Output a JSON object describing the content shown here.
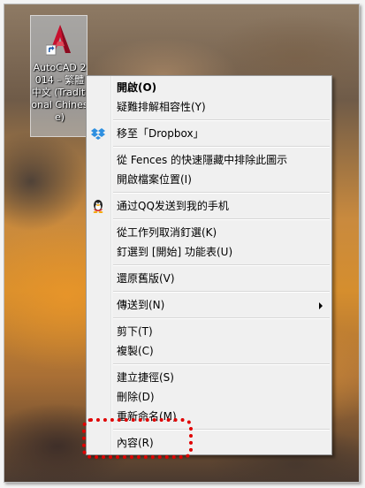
{
  "desktop_icon": {
    "label": "AutoCAD 2014 – 繁體中文 (Traditional Chinese)"
  },
  "context_menu": {
    "groups": [
      [
        {
          "label": "開啟(O)",
          "bold": true
        },
        {
          "label": "疑難排解相容性(Y)"
        }
      ],
      [
        {
          "label": "移至「Dropbox」",
          "icon": "dropbox-icon"
        }
      ],
      [
        {
          "label": "從 Fences 的快速隱藏中排除此圖示"
        },
        {
          "label": "開啟檔案位置(I)"
        }
      ],
      [
        {
          "label": "通过QQ发送到我的手机",
          "icon": "qq-penguin-icon"
        }
      ],
      [
        {
          "label": "從工作列取消釘選(K)"
        },
        {
          "label": "釘選到 [開始] 功能表(U)"
        }
      ],
      [
        {
          "label": "還原舊版(V)"
        }
      ],
      [
        {
          "label": "傳送到(N)",
          "submenu": true
        }
      ],
      [
        {
          "label": "剪下(T)"
        },
        {
          "label": "複製(C)"
        }
      ],
      [
        {
          "label": "建立捷徑(S)"
        },
        {
          "label": "刪除(D)"
        },
        {
          "label": "重新命名(M)"
        }
      ],
      [
        {
          "label": "內容(R)",
          "highlighted": true
        }
      ]
    ]
  },
  "colors": {
    "highlight": "#e00000",
    "menu_background": "#f0f0f0",
    "autocad_red": "#c8102e"
  }
}
